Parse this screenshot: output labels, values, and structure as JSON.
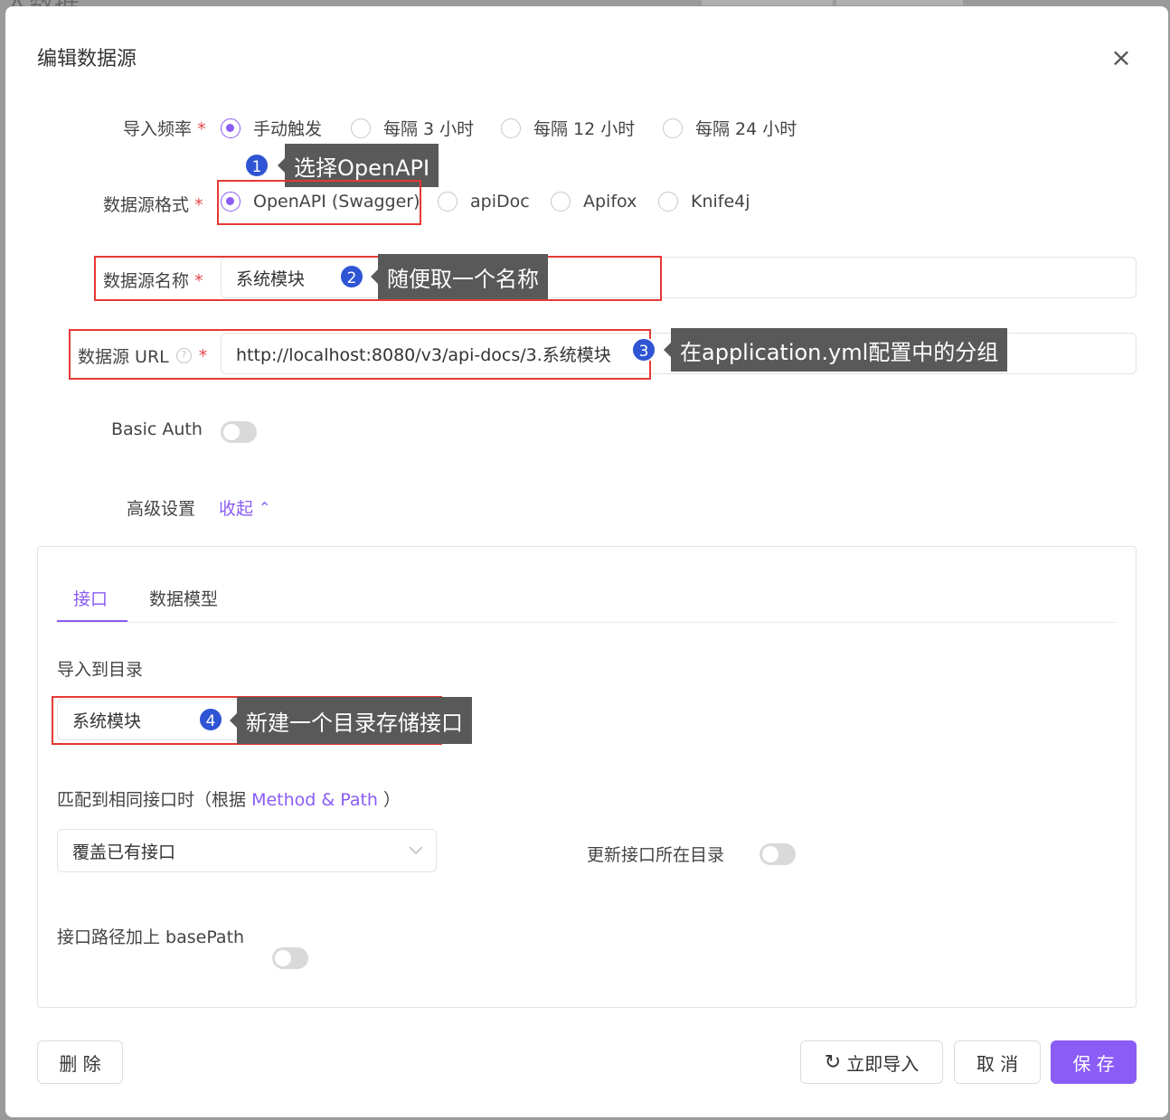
{
  "backdrop": {
    "title_fragment": "入数据"
  },
  "dialog": {
    "title": "编辑数据源",
    "close": "×"
  },
  "form": {
    "frequency": {
      "label": "导入频率",
      "required": "*",
      "options": [
        "手动触发",
        "每隔 3 小时",
        "每隔 12 小时",
        "每隔 24 小时"
      ],
      "selected": "手动触发"
    },
    "format": {
      "label": "数据源格式",
      "required": "*",
      "options": [
        "OpenAPI (Swagger)",
        "apiDoc",
        "Apifox",
        "Knife4j"
      ],
      "selected": "OpenAPI (Swagger)"
    },
    "name": {
      "label": "数据源名称",
      "required": "*",
      "value": "系统模块"
    },
    "url": {
      "label": "数据源 URL",
      "help": "?",
      "required": "*",
      "value": "http://localhost:8080/v3/api-docs/3.系统模块"
    },
    "basic_auth": {
      "label": "Basic Auth",
      "on": false
    },
    "advanced": {
      "label": "高级设置",
      "toggle_label": "收起",
      "chevron": "⌃"
    }
  },
  "panel": {
    "tabs": [
      "接口",
      "数据模型"
    ],
    "active_tab": "接口",
    "import_dir": {
      "label": "导入到目录",
      "value": "系统模块"
    },
    "match": {
      "label_prefix": "匹配到相同接口时（根据",
      "label_link": "Method & Path",
      "label_suffix": "）",
      "select_value": "覆盖已有接口"
    },
    "update_dir": {
      "label": "更新接口所在目录",
      "on": false
    },
    "base_path": {
      "label": "接口路径加上 basePath",
      "on": false
    }
  },
  "annotations": [
    {
      "num": "1",
      "text": "选择OpenAPI"
    },
    {
      "num": "2",
      "text": "随便取一个名称"
    },
    {
      "num": "3",
      "text": "在application.yml配置中的分组"
    },
    {
      "num": "4",
      "text": "新建一个目录存储接口"
    }
  ],
  "footer": {
    "delete": "删 除",
    "import_now": "立即导入",
    "refresh_icon": "↻",
    "cancel": "取 消",
    "save": "保 存"
  },
  "colors": {
    "accent": "#8b5cf6",
    "highlight": "#e53935",
    "badge": "#2f55d4",
    "tooltip": "#595959"
  }
}
